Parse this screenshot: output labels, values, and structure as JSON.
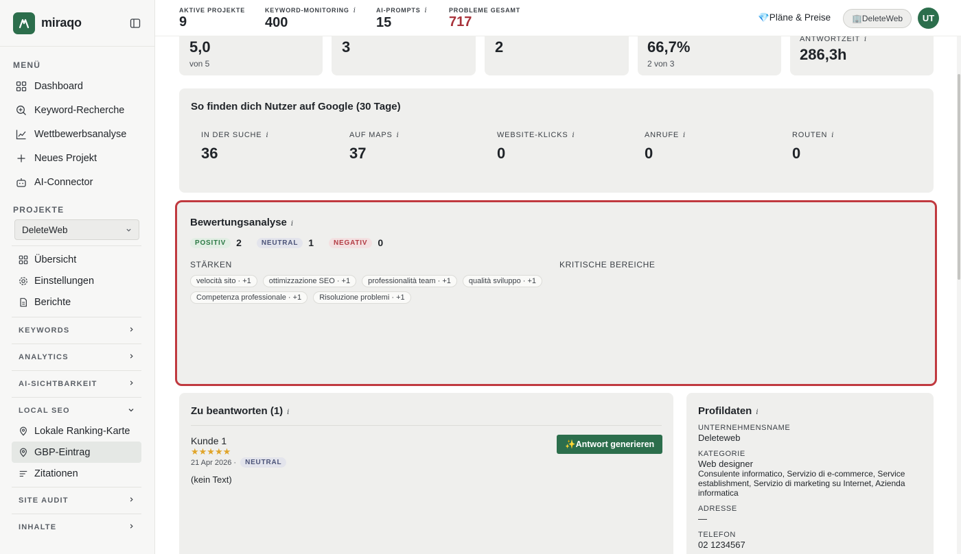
{
  "brand": {
    "name": "miraqo"
  },
  "sidebar": {
    "menu_label": "MENÜ",
    "menu": [
      {
        "label": "Dashboard",
        "icon": "grid-icon"
      },
      {
        "label": "Keyword-Recherche",
        "icon": "search-plus-icon"
      },
      {
        "label": "Wettbewerbsanalyse",
        "icon": "line-chart-icon"
      },
      {
        "label": "Neues Projekt",
        "icon": "plus-icon"
      },
      {
        "label": "AI-Connector",
        "icon": "robot-icon"
      }
    ],
    "projects_label": "PROJEKTE",
    "project_select": "DeleteWeb",
    "project_items": [
      {
        "label": "Übersicht",
        "icon": "grid-icon"
      },
      {
        "label": "Einstellungen",
        "icon": "gear-icon"
      },
      {
        "label": "Berichte",
        "icon": "document-icon"
      }
    ],
    "groups": {
      "keywords": "KEYWORDS",
      "analytics": "ANALYTICS",
      "ai": "AI-SICHTBARKEIT",
      "local": "LOCAL SEO",
      "audit": "SITE AUDIT",
      "content": "INHALTE"
    },
    "local_items": [
      {
        "label": "Lokale Ranking-Karte",
        "icon": "pin-icon"
      },
      {
        "label": "GBP-Eintrag",
        "icon": "pin-icon",
        "active": true
      },
      {
        "label": "Zitationen",
        "icon": "list-icon"
      }
    ]
  },
  "topbar": {
    "stats": [
      {
        "label": "AKTIVE PROJEKTE",
        "value": "9"
      },
      {
        "label": "KEYWORD-MONITORING",
        "value": "400",
        "info": "i"
      },
      {
        "label": "AI-PROMPTS",
        "value": "15",
        "info": "i"
      },
      {
        "label": "PROBLEME GESAMT",
        "value": "717"
      }
    ],
    "plans": "💎Pläne & Preise",
    "account": "🏢DeleteWeb",
    "avatar": "UT"
  },
  "kpis": [
    {
      "value": "5,0",
      "sub": "von 5"
    },
    {
      "value": "3",
      "sub": ""
    },
    {
      "value": "2",
      "sub": ""
    },
    {
      "value": "66,7%",
      "sub": "2 von 3"
    },
    {
      "label": "ANTWORTZEIT",
      "value": "286,3h"
    }
  ],
  "google": {
    "title": "So finden dich Nutzer auf Google (30 Tage)",
    "metrics": [
      {
        "label": "IN DER SUCHE",
        "value": "36"
      },
      {
        "label": "AUF MAPS",
        "value": "37"
      },
      {
        "label": "WEBSITE-KLICKS",
        "value": "0"
      },
      {
        "label": "ANRUFE",
        "value": "0"
      },
      {
        "label": "ROUTEN",
        "value": "0"
      }
    ]
  },
  "ratings": {
    "title": "Bewertungsanalyse",
    "positive_label": "POSITIV",
    "positive_count": "2",
    "neutral_label": "NEUTRAL",
    "neutral_count": "1",
    "negative_label": "NEGATIV",
    "negative_count": "0",
    "strengths_label": "STÄRKEN",
    "critical_label": "KRITISCHE BEREICHE",
    "strengths": [
      "velocità sito · +1",
      "ottimizzazione SEO · +1",
      "professionalità team · +1",
      "qualità sviluppo · +1",
      "Competenza professionale · +1",
      "Risoluzione problemi · +1"
    ]
  },
  "answers": {
    "title": "Zu beantworten (1)",
    "reviewer": "Kunde 1",
    "stars": "★★★★★",
    "date": "21 Apr 2026 ·",
    "sentiment": "NEUTRAL",
    "text": "(kein Text)",
    "generate_label": "✨Antwort generieren"
  },
  "profile": {
    "title": "Profildaten",
    "company_label": "UNTERNEHMENSNAME",
    "company": "Deleteweb",
    "category_label": "KATEGORIE",
    "category": "Web designer",
    "category_extra": "Consulente informatico, Servizio di e-commerce, Service establishment, Servizio di marketing su Internet, Azienda informatica",
    "address_label": "ADRESSE",
    "address": "—",
    "phone_label": "TELEFON",
    "phone": "02 1234567"
  },
  "colors": {
    "brand": "#2c6e4c",
    "danger": "#a8323a",
    "highlight": "#c0393f"
  }
}
